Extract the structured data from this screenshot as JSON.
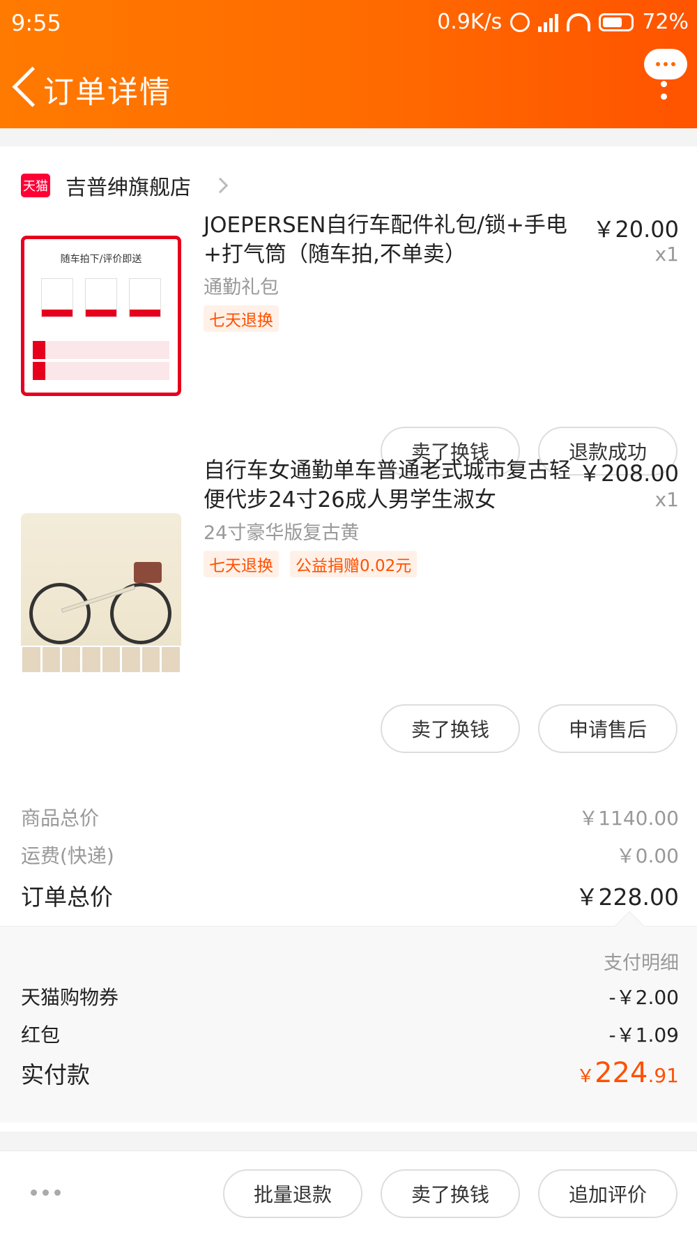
{
  "status": {
    "time": "9:55",
    "net_speed": "0.9K/s",
    "battery": "72%"
  },
  "nav": {
    "title": "订单详情"
  },
  "store": {
    "badge": "天猫",
    "name": "吉普绅旗舰店"
  },
  "items": [
    {
      "name": "JOEPERSEN自行车配件礼包/锁+手电+打气筒（随车拍,不单卖）",
      "price": "￥20.00",
      "qty": "x1",
      "sku": "通勤礼包",
      "tags": [
        "七天退换"
      ],
      "thumb_header": "随车拍下/评价即送",
      "buttons": [
        "卖了换钱",
        "退款成功"
      ]
    },
    {
      "name": "自行车女通勤单车普通老式城市复古轻便代步24寸26成人男学生淑女",
      "price": "￥208.00",
      "qty": "x1",
      "sku": "24寸豪华版复古黄",
      "tags": [
        "七天退换",
        "公益捐赠0.02元"
      ],
      "buttons": [
        "卖了换钱",
        "申请售后"
      ]
    }
  ],
  "summary": {
    "goods_total_label": "商品总价",
    "goods_total": "￥1140.00",
    "shipping_label": "运费(快递)",
    "shipping": "￥0.00",
    "order_total_label": "订单总价",
    "order_total": "￥228.00"
  },
  "payment": {
    "title": "支付明细",
    "coupon_label": "天猫购物券",
    "coupon": "-￥2.00",
    "redpacket_label": "红包",
    "redpacket": "-￥1.09",
    "paid_label": "实付款",
    "paid_currency": "￥",
    "paid_int": "224",
    "paid_dec": ".91"
  },
  "bottom_bar": {
    "buttons": [
      "批量退款",
      "卖了换钱",
      "追加评价"
    ]
  },
  "colors": {
    "brand_orange": "#ff5000",
    "tmall_red": "#ff0036"
  }
}
